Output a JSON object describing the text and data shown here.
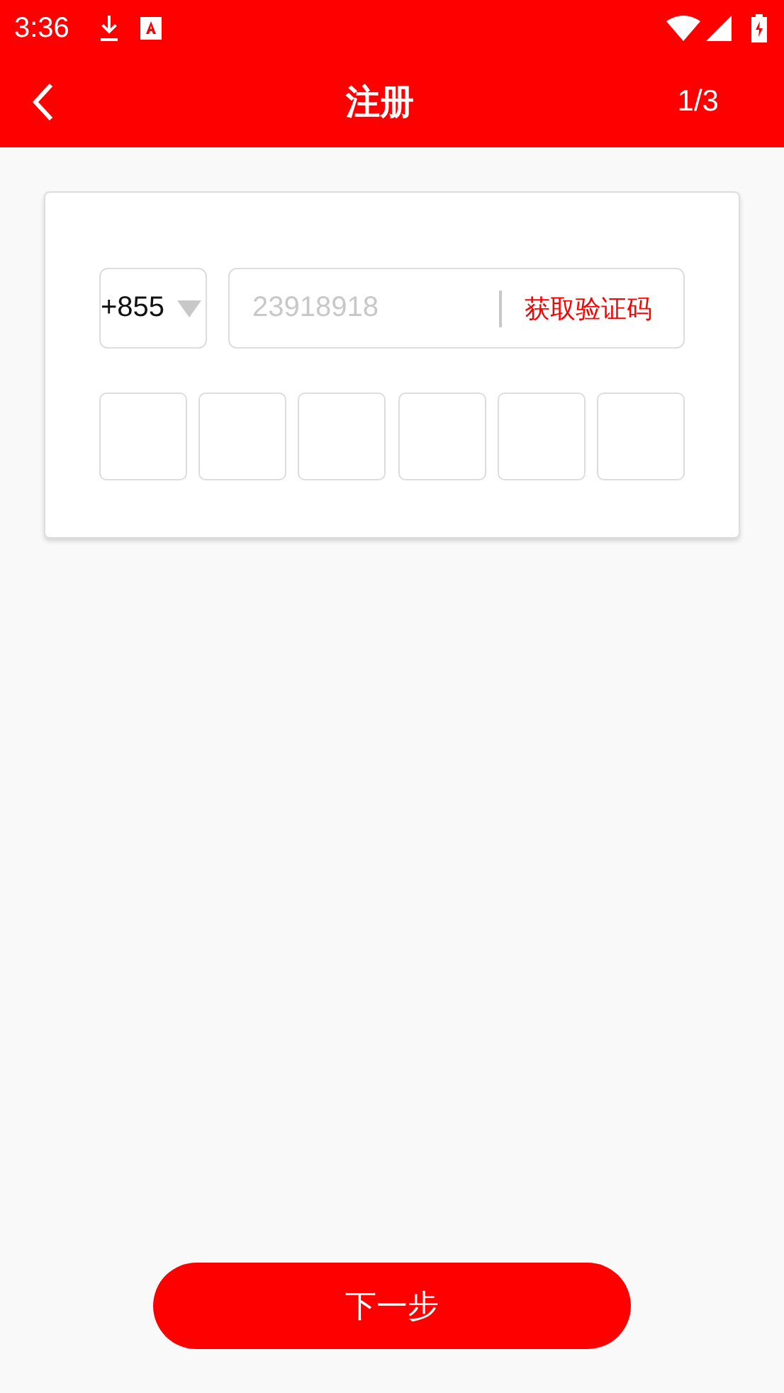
{
  "status_bar": {
    "time": "3:36"
  },
  "app_bar": {
    "title": "注册",
    "step": "1/3"
  },
  "form": {
    "country_code": "+855",
    "phone": {
      "placeholder": "23918918"
    },
    "get_code_link": "获取验证码",
    "code_boxes": [
      {
        "kind": "digit"
      },
      {
        "kind": "digit"
      },
      {
        "kind": "digit"
      },
      {
        "kind": "digit"
      },
      {
        "kind": "digit"
      },
      {
        "kind": "digit"
      }
    ]
  },
  "next_button": "下一步"
}
